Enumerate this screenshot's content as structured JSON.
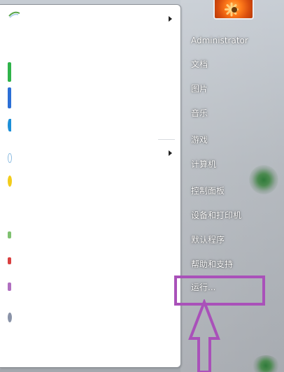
{
  "user": {
    "name": "Administrator"
  },
  "right_menu": {
    "items": [
      {
        "label": "文档"
      },
      {
        "label": "图片"
      },
      {
        "label": "音乐"
      },
      {
        "label": "游戏"
      },
      {
        "label": "计算机"
      },
      {
        "label": "控制面板"
      },
      {
        "label": "设备和打印机"
      },
      {
        "label": "默认程序"
      },
      {
        "label": "帮助和支持"
      },
      {
        "label": "运行..."
      }
    ]
  },
  "annotation": {
    "highlight_color": "#a951b9"
  },
  "colors": {
    "menu_text": "#ffffff",
    "left_pane": "#ffffff"
  }
}
